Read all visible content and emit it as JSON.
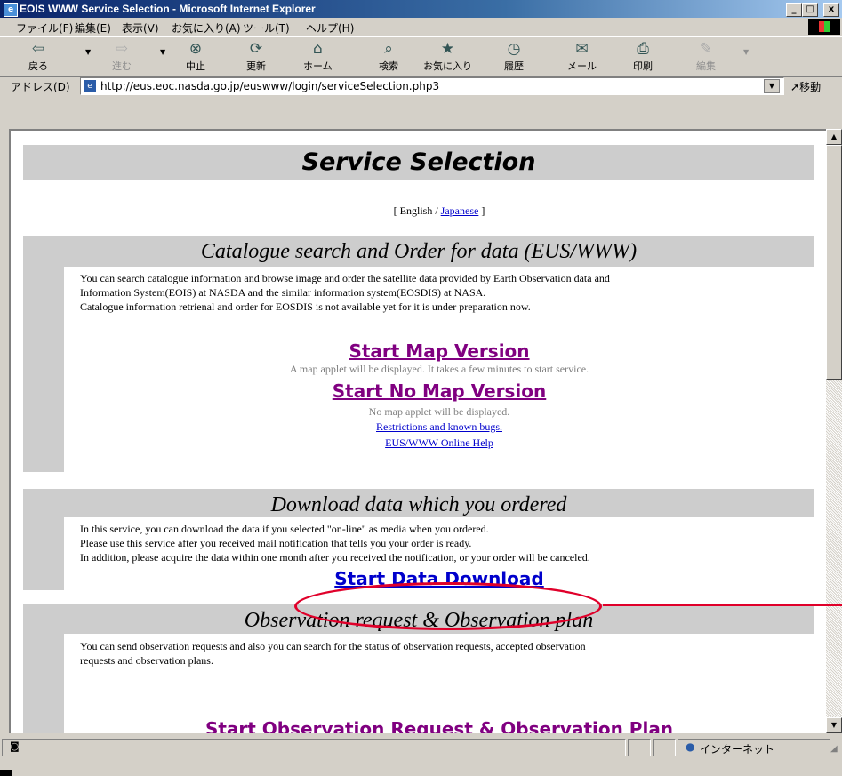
{
  "window": {
    "title": "EOIS WWW Service Selection - Microsoft Internet Explorer",
    "app_icon": "ie-icon",
    "controls": [
      "_",
      "□",
      "x"
    ]
  },
  "menubar": {
    "items": [
      "ファイル(F)",
      "編集(E)",
      "表示(V)",
      "お気に入り(A)",
      "ツール(T)",
      "ヘルプ(H)"
    ]
  },
  "toolbar": {
    "back": "戻る",
    "forward": "進む",
    "stop": "中止",
    "refresh": "更新",
    "home": "ホーム",
    "search": "検索",
    "favorites": "お気に入り",
    "history": "履歴",
    "mail": "メール",
    "print": "印刷",
    "edit": "編集"
  },
  "address": {
    "label": "アドレス(D)",
    "url": "http://eus.eoc.nasda.go.jp/euswww/login/serviceSelection.php3",
    "go": "移動"
  },
  "page": {
    "title": "Service Selection",
    "lang_prefix": "[ English / ",
    "lang_link": "Japanese",
    "lang_suffix": " ]",
    "section1": {
      "heading": "Catalogue search and Order for data (EUS/WWW)",
      "lines": [
        "You can search catalogue information and browse image and order the satellite data provided by Earth Observation data and",
        "Information System(EOIS) at NASDA and the similar information system(EOSDIS) at NASA.",
        "Catalogue information retrienal and order for EOSDIS is not available yet for it is under preparation now."
      ],
      "map_link": "Start Map Version",
      "map_note": "A map applet will be displayed. It takes a few minutes to start service.",
      "nomap_link": "Start No Map Version",
      "nomap_note": "No map applet will be displayed.",
      "restrictions_link": "Restrictions and known bugs.",
      "help_link": "EUS/WWW Online Help"
    },
    "section2": {
      "heading": "Download data which you ordered",
      "lines": [
        "In this service, you can download the data if you selected \"on-line\" as media when you ordered.",
        "Please use this service after you received mail notification that tells you your order is ready.",
        "In addition, please acquire the data within one month after you received the notification, or your order will be canceled."
      ],
      "download_link": "Start Data Download"
    },
    "section3": {
      "heading": "Observation request & Observation plan",
      "lines": [
        "You can send observation requests and also you can search for the status of observation requests, accepted observation",
        "requests and observation plans."
      ],
      "obs_link": "Start Observation Request & Observation Plan"
    }
  },
  "statusbar": {
    "zone": "インターネット"
  },
  "colors": {
    "annotation": "#e0002a",
    "visited_link": "#800080",
    "link": "#0000cc",
    "header_gray": "#cdcdcd"
  }
}
